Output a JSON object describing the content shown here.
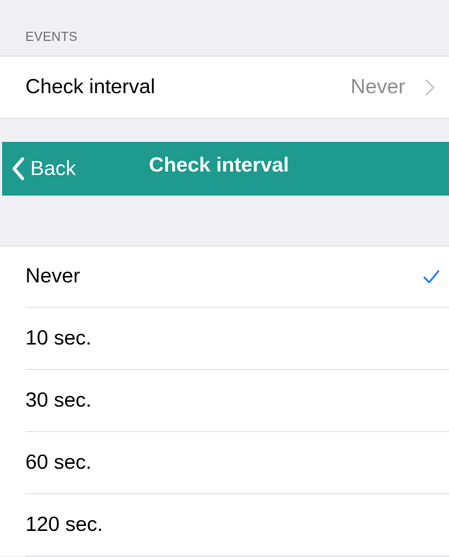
{
  "settings": {
    "section_header": "EVENTS",
    "check_interval_row": {
      "label": "Check interval",
      "value": "Never"
    }
  },
  "navbar": {
    "back_label": "Back",
    "title": "Check interval",
    "background_color": "#1e9a8f"
  },
  "options": [
    {
      "label": "Never",
      "selected": true
    },
    {
      "label": "10 sec.",
      "selected": false
    },
    {
      "label": "30 sec.",
      "selected": false
    },
    {
      "label": "60 sec.",
      "selected": false
    },
    {
      "label": "120 sec.",
      "selected": false
    }
  ],
  "colors": {
    "accent_check": "#1a7cf5",
    "group_background": "#efeff4",
    "secondary_text": "#8e8e93"
  },
  "icons": {
    "back": "chevron-left-icon",
    "disclosure": "chevron-right-icon",
    "selected": "checkmark-icon"
  }
}
